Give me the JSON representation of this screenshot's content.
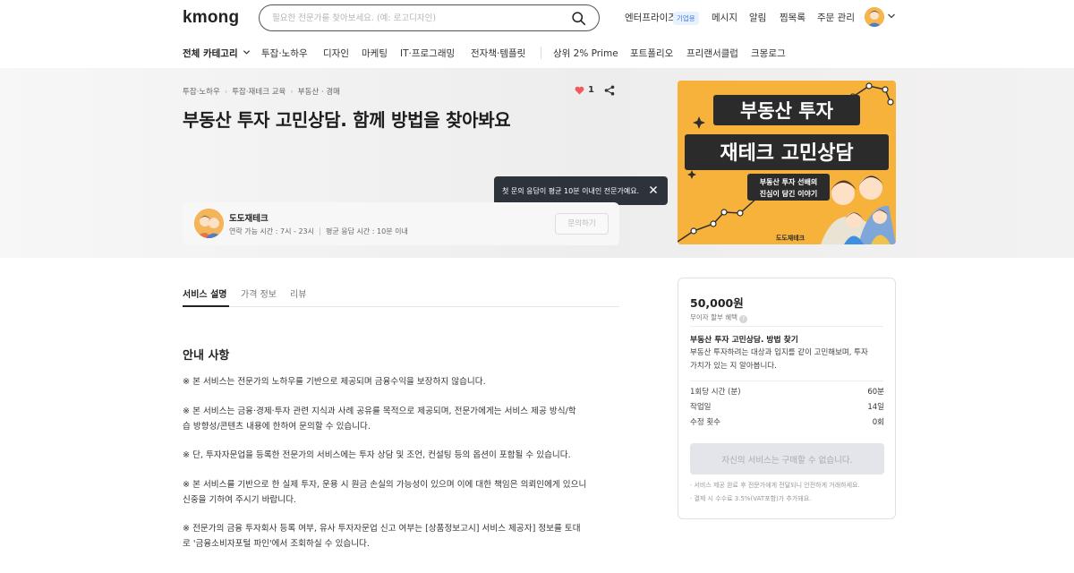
{
  "header": {
    "logo": "kmong",
    "search_placeholder": "필요한 전문가를 찾아보세요. (예: 로고디자인)",
    "nav": {
      "enterprise": "엔터프라이즈",
      "enterprise_badge": "기업용",
      "messages": "메시지",
      "notifications": "알림",
      "favorites": "찜목록",
      "orders": "주문 관리"
    }
  },
  "categories": {
    "all": "전체 카테고리",
    "items": [
      "투잡·노하우",
      "디자인",
      "마케팅",
      "IT·프로그래밍",
      "전자책·템플릿"
    ],
    "extra": [
      "상위 2% Prime",
      "포트폴리오",
      "프리랜서클럽",
      "크몽로그"
    ]
  },
  "service": {
    "breadcrumb": [
      "투잡·노하우",
      "투잡·재테크 교육",
      "부동산 · 경매"
    ],
    "likes": "1",
    "title": "부동산 투자 고민상담. 함께 방법을 찾아봐요",
    "tooltip": "첫 문의 응답이 평균 10분 이내인 전문가예요.",
    "thumbnail": {
      "line1": "부동산 투자",
      "line2": "재테크 고민상담",
      "sub1": "부동산 투자 선배의",
      "sub2": "진심이 담긴 이야기",
      "brand": "도도재테크"
    }
  },
  "seller": {
    "name": "도도재테크",
    "contact_hours": "연락 가능 시간 : 7시 - 23시",
    "response_time": "평균 응답 시간 : 10분 이내",
    "contact_button": "문의하기"
  },
  "tabs": [
    "서비스 설명",
    "가격 정보",
    "리뷰"
  ],
  "content": {
    "section_title": "안내 사항",
    "paragraphs": [
      [
        "※ 본 서비스는 전문가의 노하우를 기반으로 제공되며 금융수익을 보장하지 않습니다."
      ],
      [
        "※ 본 서비스는 금융·경제·투자 관련 지식과 사례 공유를 목적으로 제공되며, 전문가에게는 서비스 제공 방식/학",
        "습 방향성/콘텐츠 내용에 한하여 문의할 수 있습니다."
      ],
      [
        "※ 단, 투자자문업을 등록한 전문가의 서비스에는 투자 상담 및 조언, 컨설팅 등의 옵션이 포함될 수 있습니다."
      ],
      [
        "※ 본 서비스를 기반으로 한 실제 투자, 운용 시 원금 손실의 가능성이 있으며 이에 대한 책임은 의뢰인에게 있으니",
        "신중을 기하여 주시기 바랍니다."
      ],
      [
        "※ 전문가의 금융 투자회사 등록 여부, 유사 투자자문업 신고 여부는 [상품정보고시] 서비스 제공자] 정보를 토대",
        "로 '금융소비자포털 파인'에서 조회하실 수 있습니다."
      ]
    ]
  },
  "purchase": {
    "price": "50,000원",
    "installment": "무이자 할부 혜택",
    "package_title": "부동산 투자 고민상담. 방법 찾기",
    "package_desc": [
      "부동산 투자하려는 대상과 입지를 같이 고민해보며, 투자",
      "가치가 있는 지 알아봅니다."
    ],
    "specs": [
      {
        "label": "1회당 시간 (분)",
        "value": "60분"
      },
      {
        "label": "작업일",
        "value": "14일"
      },
      {
        "label": "수정 횟수",
        "value": "0회"
      }
    ],
    "buy_button": "자신의 서비스는 구매할 수 없습니다.",
    "notes": [
      "· 서비스 제공 완료 후 전문가에게 전달되니 안전하게 거래하세요.",
      "· 결제 시 수수료 3.5%(VAT포함)가 추가돼요."
    ]
  }
}
